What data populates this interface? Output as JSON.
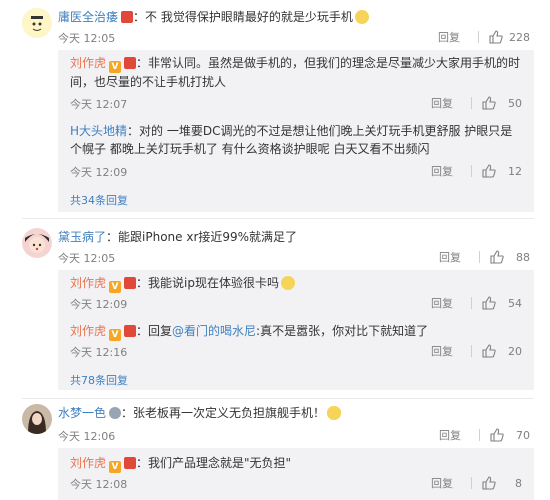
{
  "comments": [
    {
      "user": "庸医全治痿",
      "text": "：不 我觉得保护眼睛最好的就是少玩手机",
      "time": "今天 12:05",
      "reply": "回复",
      "likes": "228",
      "replies": [
        {
          "user": "刘作虎",
          "text": "：非常认同。虽然是做手机的，但我们的理念是尽量减少大家用手机的时间，也尽量的不让手机打扰人",
          "time": "今天 12:07",
          "reply": "回复",
          "likes": "50"
        },
        {
          "user": "H大头地精",
          "text": "：对的 一堆要DC调光的不过是想让他们晚上关灯玩手机更舒服 护眼只是个幌子 都晚上关灯玩手机了 有什么资格谈护眼呢 白天又看不出频闪",
          "time": "今天 12:09",
          "reply": "回复",
          "likes": "12"
        }
      ],
      "more": "共34条回复"
    },
    {
      "user": "黛玉病了",
      "text": "：能跟iPhone xr接近99%就满足了",
      "time": "今天 12:05",
      "reply": "回复",
      "likes": "88",
      "replies": [
        {
          "user": "刘作虎",
          "text": "：我能说ip现在体验很卡吗",
          "time": "今天 12:09",
          "reply": "回复",
          "likes": "54"
        },
        {
          "user": "刘作虎",
          "prefix": "：回复",
          "mention": "@看门的喝水尼",
          "text": ":真不是嚣张，你对比下就知道了",
          "time": "今天 12:16",
          "reply": "回复",
          "likes": "20"
        }
      ],
      "more": "共78条回复"
    },
    {
      "user": "水梦一色",
      "text": "：张老板再一次定义无负担旗舰手机！",
      "time": "今天 12:06",
      "reply": "回复",
      "likes": "70",
      "replies": [
        {
          "user": "刘作虎",
          "text": "：我们产品理念就是\"无负担\"",
          "time": "今天 12:08",
          "reply": "回复",
          "likes": "8"
        }
      ]
    }
  ],
  "colors": {
    "name": "#eb7350",
    "link": "#4080c0",
    "subbg": "#f2f2f5"
  },
  "icons": {
    "like": "thumbs-up-icon",
    "vip": "v-badge-icon",
    "crown": "crown-badge-icon"
  }
}
